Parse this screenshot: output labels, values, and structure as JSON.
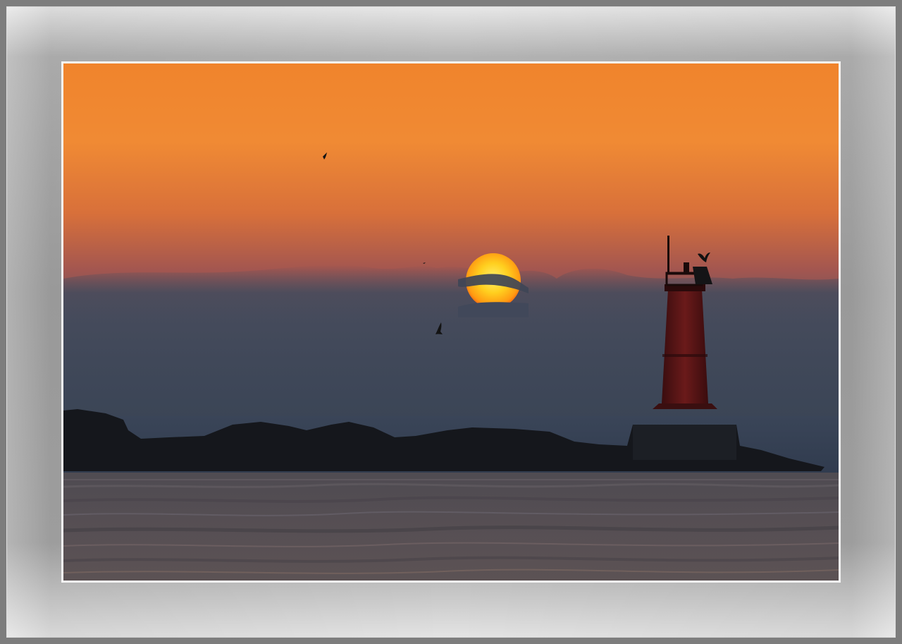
{
  "scene": {
    "subject": "sunset-over-sea-with-lighthouse",
    "colors": {
      "sky_top": "#f0862f",
      "sky_mid": "#e9772f",
      "sky_low": "#b0584a",
      "haze": "#3f4757",
      "sea": "#2c3444",
      "sun": "#ffc21a",
      "sun_edge": "#ff5a10",
      "lighthouse": "#5a1414",
      "rocks": "#15171c",
      "mat": "#a6a6a6"
    }
  }
}
